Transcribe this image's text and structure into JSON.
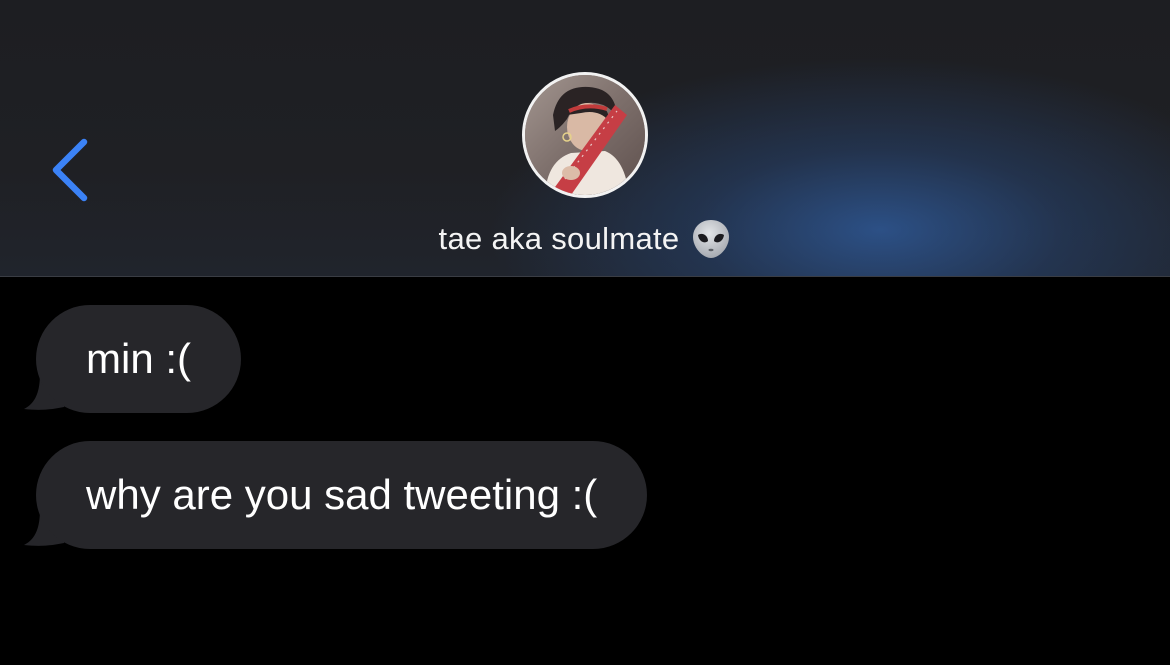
{
  "header": {
    "back_icon": "chevron-left-icon",
    "contact_name": "tae aka soulmate",
    "contact_emoji": "alien-emoji-icon",
    "accent_color": "#3b82f6",
    "avatar_label": "contact avatar photo"
  },
  "messages": [
    {
      "direction": "incoming",
      "text": "min :("
    },
    {
      "direction": "incoming",
      "text": "why are you sad tweeting :("
    }
  ],
  "colors": {
    "background": "#000000",
    "bubble_incoming": "#26262a",
    "text": "#ffffff"
  }
}
